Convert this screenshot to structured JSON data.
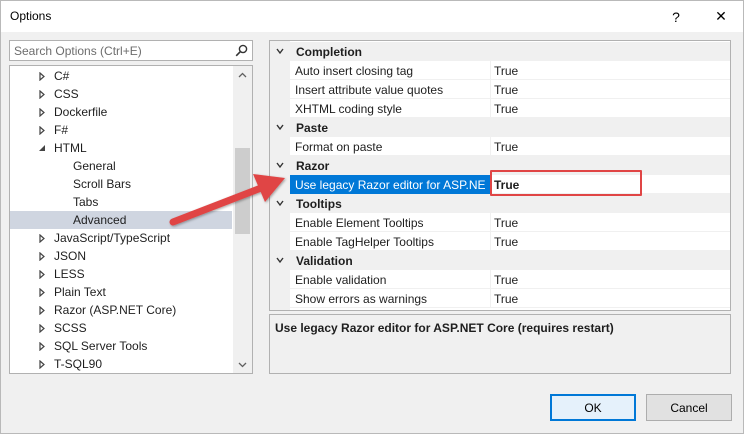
{
  "window": {
    "title": "Options",
    "help_glyph": "?",
    "close_glyph": "✕"
  },
  "search": {
    "placeholder": "Search Options (Ctrl+E)",
    "icon": "search-icon"
  },
  "tree": {
    "items": [
      {
        "label": "C#",
        "level": 0,
        "expander": "collapsed"
      },
      {
        "label": "CSS",
        "level": 0,
        "expander": "collapsed"
      },
      {
        "label": "Dockerfile",
        "level": 0,
        "expander": "collapsed"
      },
      {
        "label": "F#",
        "level": 0,
        "expander": "collapsed"
      },
      {
        "label": "HTML",
        "level": 0,
        "expander": "expanded"
      },
      {
        "label": "General",
        "level": 1,
        "expander": "none"
      },
      {
        "label": "Scroll Bars",
        "level": 1,
        "expander": "none"
      },
      {
        "label": "Tabs",
        "level": 1,
        "expander": "none"
      },
      {
        "label": "Advanced",
        "level": 1,
        "expander": "none",
        "selected": true
      },
      {
        "label": "JavaScript/TypeScript",
        "level": 0,
        "expander": "collapsed"
      },
      {
        "label": "JSON",
        "level": 0,
        "expander": "collapsed"
      },
      {
        "label": "LESS",
        "level": 0,
        "expander": "collapsed"
      },
      {
        "label": "Plain Text",
        "level": 0,
        "expander": "collapsed"
      },
      {
        "label": "Razor (ASP.NET Core)",
        "level": 0,
        "expander": "collapsed"
      },
      {
        "label": "SCSS",
        "level": 0,
        "expander": "collapsed"
      },
      {
        "label": "SQL Server Tools",
        "level": 0,
        "expander": "collapsed"
      },
      {
        "label": "T-SQL90",
        "level": 0,
        "expander": "collapsed"
      }
    ]
  },
  "grid": {
    "categories": [
      {
        "name": "Completion",
        "properties": [
          {
            "name": "Auto insert closing tag",
            "value": "True"
          },
          {
            "name": "Insert attribute value quotes",
            "value": "True"
          },
          {
            "name": "XHTML coding style",
            "value": "True"
          }
        ]
      },
      {
        "name": "Paste",
        "properties": [
          {
            "name": "Format on paste",
            "value": "True"
          }
        ]
      },
      {
        "name": "Razor",
        "properties": [
          {
            "name": "Use legacy Razor editor for ASP.NET Core",
            "value": "True",
            "selected": true
          }
        ]
      },
      {
        "name": "Tooltips",
        "properties": [
          {
            "name": "Enable Element Tooltips",
            "value": "True"
          },
          {
            "name": "Enable TagHelper Tooltips",
            "value": "True"
          }
        ]
      },
      {
        "name": "Validation",
        "properties": [
          {
            "name": "Enable validation",
            "value": "True"
          },
          {
            "name": "Show errors as warnings",
            "value": "True"
          }
        ]
      }
    ]
  },
  "description": {
    "text": "Use legacy Razor editor for ASP.NET Core (requires restart)"
  },
  "buttons": {
    "ok": "OK",
    "cancel": "Cancel"
  },
  "colors": {
    "selection_blue": "#0078d7",
    "annotation_red": "#e04545"
  }
}
